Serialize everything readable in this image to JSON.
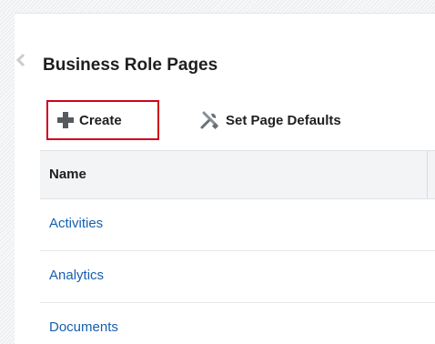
{
  "page": {
    "title": "Business Role Pages"
  },
  "toolbar": {
    "create_label": "Create",
    "set_defaults_label": "Set Page Defaults"
  },
  "table": {
    "columns": [
      "Name"
    ],
    "rows": [
      {
        "name": "Activities"
      },
      {
        "name": "Analytics"
      },
      {
        "name": "Documents"
      }
    ]
  },
  "icons": {
    "create": "plus-icon",
    "set_defaults": "tools-icon",
    "collapse": "chevron-left-icon"
  },
  "colors": {
    "highlight_border": "#d0021b",
    "link": "#1560b0",
    "header_bg": "#f2f4f6"
  }
}
